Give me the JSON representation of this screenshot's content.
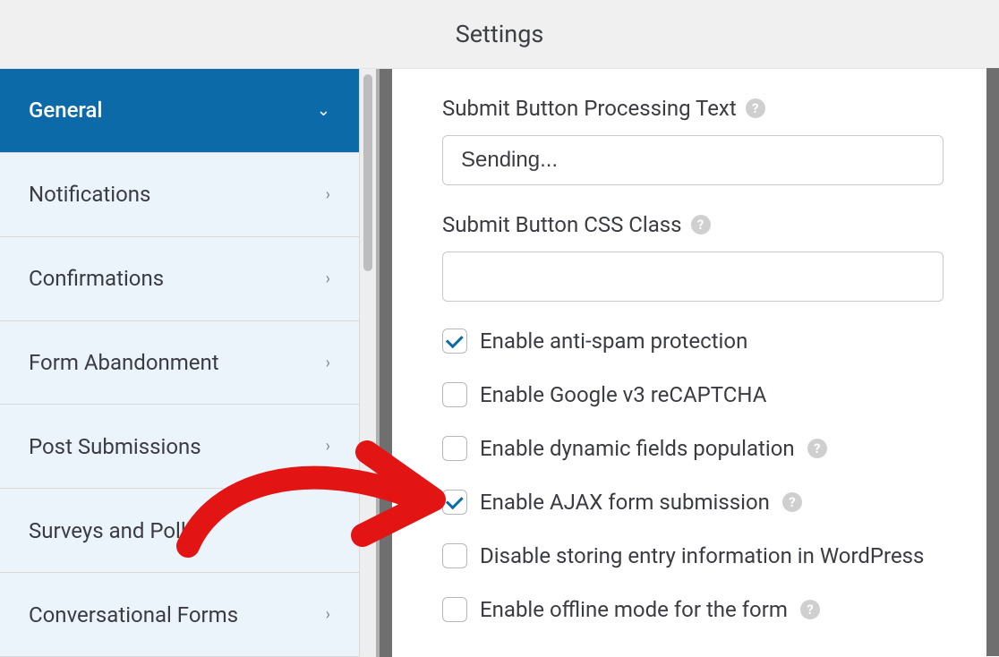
{
  "header": {
    "title": "Settings"
  },
  "sidebar": {
    "items": [
      {
        "label": "General",
        "expanded": true,
        "active": true
      },
      {
        "label": "Notifications",
        "expanded": false,
        "active": false
      },
      {
        "label": "Confirmations",
        "expanded": false,
        "active": false
      },
      {
        "label": "Form Abandonment",
        "expanded": false,
        "active": false
      },
      {
        "label": "Post Submissions",
        "expanded": false,
        "active": false
      },
      {
        "label": "Surveys and Polls",
        "expanded": false,
        "active": false
      },
      {
        "label": "Conversational Forms",
        "expanded": false,
        "active": false
      }
    ]
  },
  "form": {
    "submit_processing": {
      "label": "Submit Button Processing Text",
      "value": "Sending..."
    },
    "submit_css_class": {
      "label": "Submit Button CSS Class",
      "value": ""
    },
    "checkboxes": [
      {
        "label": "Enable anti-spam protection",
        "checked": true,
        "help": false
      },
      {
        "label": "Enable Google v3 reCAPTCHA",
        "checked": false,
        "help": false
      },
      {
        "label": "Enable dynamic fields population",
        "checked": false,
        "help": true
      },
      {
        "label": "Enable AJAX form submission",
        "checked": true,
        "help": true
      },
      {
        "label": "Disable storing entry information in WordPress",
        "checked": false,
        "help": false
      },
      {
        "label": "Enable offline mode for the form",
        "checked": false,
        "help": true
      }
    ]
  },
  "icons": {
    "chevron_down": "⌄",
    "chevron_right": "›",
    "help": "?"
  }
}
